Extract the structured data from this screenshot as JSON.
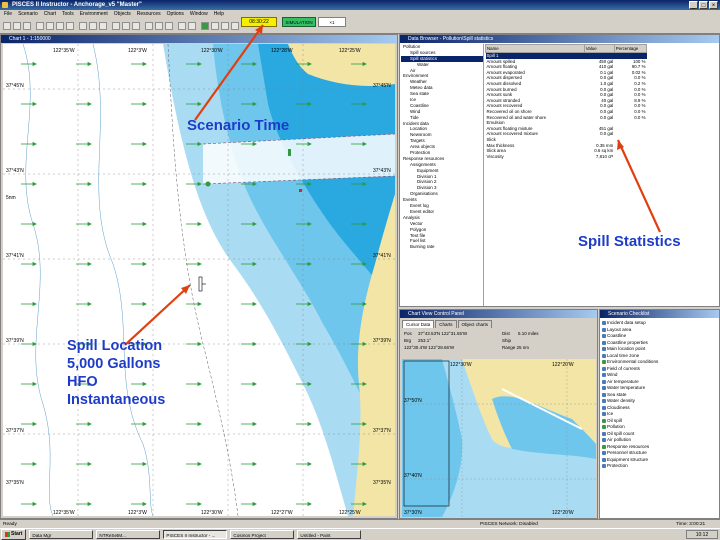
{
  "app": {
    "title": "PISCES II Instructor - Anchorage_v5 \"Master\"",
    "window_buttons": [
      "_",
      "□",
      "×"
    ]
  },
  "menu": [
    "File",
    "Scenario",
    "Chart",
    "Tools",
    "Environment",
    "Objects",
    "Resources",
    "Options",
    "Window",
    "Help"
  ],
  "toolbar": {
    "scenario_time": "08:30:22",
    "green_label": "SIMULATION",
    "speed": "×1"
  },
  "chart_window": {
    "title": "Chart 1 - 1:150000",
    "lon_labels": [
      "122°35'W",
      "122°3'W",
      "122°30'W",
      "122°28'W",
      "122°25'W"
    ],
    "lon_labels_bottom": [
      "122°35'W",
      "122°3'W",
      "122°30'W",
      "122°27'W",
      "122°25'W"
    ],
    "lat_labels_left": [
      "37°45'N",
      "37°43'N",
      "37°41'N",
      "37°39'N",
      "37°37'N",
      "37°35'N"
    ],
    "lat_labels_right": [
      "37°45'N",
      "37°43'N",
      "37°41'N",
      "37°39'N",
      "37°37'N",
      "37°35'N"
    ],
    "scale_label": "5nm"
  },
  "data_browser": {
    "title": "Data Browser - Pollution\\Spill statistics",
    "tree": [
      {
        "indent": 0,
        "label": "Pollution"
      },
      {
        "indent": 1,
        "label": "Spill sources"
      },
      {
        "indent": 1,
        "label": "Spill statistics",
        "selected": true
      },
      {
        "indent": 2,
        "label": "Water"
      },
      {
        "indent": 1,
        "label": "Air"
      },
      {
        "indent": 0,
        "label": "Environment"
      },
      {
        "indent": 1,
        "label": "Weather"
      },
      {
        "indent": 1,
        "label": "Meteo data"
      },
      {
        "indent": 1,
        "label": "Sea state"
      },
      {
        "indent": 1,
        "label": "Ice"
      },
      {
        "indent": 1,
        "label": "Coastline"
      },
      {
        "indent": 1,
        "label": "Wind"
      },
      {
        "indent": 1,
        "label": "Tide"
      },
      {
        "indent": 0,
        "label": "Incident data"
      },
      {
        "indent": 1,
        "label": "Location"
      },
      {
        "indent": 1,
        "label": "Newsroom"
      },
      {
        "indent": 1,
        "label": "Targets"
      },
      {
        "indent": 1,
        "label": "Area objects"
      },
      {
        "indent": 1,
        "label": "Protection"
      },
      {
        "indent": 0,
        "label": "Response resources"
      },
      {
        "indent": 1,
        "label": "Assignments"
      },
      {
        "indent": 2,
        "label": "Equipment"
      },
      {
        "indent": 2,
        "label": "Division 1"
      },
      {
        "indent": 2,
        "label": "Division 2"
      },
      {
        "indent": 2,
        "label": "Division 3"
      },
      {
        "indent": 1,
        "label": "Organisations"
      },
      {
        "indent": 0,
        "label": "Events"
      },
      {
        "indent": 1,
        "label": "Event log"
      },
      {
        "indent": 1,
        "label": "Event editor"
      },
      {
        "indent": 0,
        "label": "Analysis"
      },
      {
        "indent": 1,
        "label": "Vector"
      },
      {
        "indent": 1,
        "label": "Polygon"
      },
      {
        "indent": 1,
        "label": "Text file"
      },
      {
        "indent": 1,
        "label": "Fuel list"
      },
      {
        "indent": 1,
        "label": "Burning rate"
      }
    ],
    "columns": [
      "Name",
      "Value",
      "Percentage"
    ],
    "rows": [
      {
        "name": "Spill 1",
        "value": "",
        "pct": "",
        "sel": true
      },
      {
        "name": "Amount spilled",
        "value": "450 gal",
        "pct": "100 %"
      },
      {
        "name": "Amount floating",
        "value": "410 gal",
        "pct": "90.7 %"
      },
      {
        "name": "Amount evaporated",
        "value": "0.1 gal",
        "pct": "0.02 %"
      },
      {
        "name": "Amount dispersed",
        "value": "0.0 gal",
        "pct": "0.0 %"
      },
      {
        "name": "Amount dissolved",
        "value": "1.0 gal",
        "pct": "0.2 %"
      },
      {
        "name": "Amount burned",
        "value": "0.0 gal",
        "pct": "0.0 %"
      },
      {
        "name": "Amount sunk",
        "value": "0.0 gal",
        "pct": "0.0 %"
      },
      {
        "name": "Amount stranded",
        "value": "40 gal",
        "pct": "8.9 %"
      },
      {
        "name": "Amount recovered",
        "value": "0.0 gal",
        "pct": "0.0 %"
      },
      {
        "name": "Recovered oil on shore",
        "value": "0.0 gal",
        "pct": "0.0 %"
      },
      {
        "name": "Recovered oil and water shore",
        "value": "0.0 gal",
        "pct": "0.0 %"
      },
      {
        "name": "Emulsion",
        "value": "",
        "pct": ""
      },
      {
        "name": "Amount floating mixture",
        "value": "451 gal",
        "pct": ""
      },
      {
        "name": "Amount recovered mixture",
        "value": "0.0 gal",
        "pct": ""
      },
      {
        "name": "Slick",
        "value": "",
        "pct": ""
      },
      {
        "name": "Max thickness",
        "value": "0.35 mm",
        "pct": ""
      },
      {
        "name": "Slick area",
        "value": "0.6 sq km",
        "pct": ""
      },
      {
        "name": "Viscosity",
        "value": "7,810 cP",
        "pct": ""
      }
    ]
  },
  "view_control": {
    "title": "Chart View Control Panel",
    "tabs": [
      "Cursor Data",
      "Charts",
      "Object charts"
    ],
    "pos_label": "Pos",
    "pos_value": "37°43.53'N 122°31.55'W",
    "dist_label": "Dist",
    "dist_value": "5.10 miles",
    "brg_label": "Brg",
    "brg_value": "253.1°",
    "row2": "122°30.4'W  122°28.66'W",
    "row3": "Ship",
    "row4": "Range 25 nm",
    "minimap_lon": [
      "122°30'W",
      "122°20'W"
    ],
    "minimap_lat": [
      "37°50'N",
      "37°40'N",
      "37°30'N"
    ]
  },
  "checklist": {
    "title": "Scenario Checklist",
    "items": [
      {
        "label": "Incident data setup",
        "icon": "blue"
      },
      {
        "label": "Layout area",
        "icon": "blue"
      },
      {
        "label": "Coastline",
        "icon": "blue"
      },
      {
        "label": "Coastline properties",
        "icon": "blue"
      },
      {
        "label": "Main location point",
        "icon": "blue"
      },
      {
        "label": "Local time zone",
        "icon": "blue"
      },
      {
        "label": "Environmental conditions",
        "icon": "green"
      },
      {
        "label": "Field of currents",
        "icon": "blue"
      },
      {
        "label": "Wind",
        "icon": "blue"
      },
      {
        "label": "Air temperature",
        "icon": "blue"
      },
      {
        "label": "Water temperature",
        "icon": "blue"
      },
      {
        "label": "Sea state",
        "icon": "blue"
      },
      {
        "label": "Water density",
        "icon": "blue"
      },
      {
        "label": "Cloudiness",
        "icon": "blue"
      },
      {
        "label": "Ice",
        "icon": "blue"
      },
      {
        "label": "Oil spill",
        "icon": "green"
      },
      {
        "label": "Pollution",
        "icon": "green"
      },
      {
        "label": "Oil spill count",
        "icon": "blue"
      },
      {
        "label": "Air pollution",
        "icon": "blue"
      },
      {
        "label": "Response resources",
        "icon": "green"
      },
      {
        "label": "Personnel structure",
        "icon": "blue"
      },
      {
        "label": "Equipment structure",
        "icon": "blue"
      },
      {
        "label": "Protection",
        "icon": "blue"
      }
    ]
  },
  "statusbar": {
    "left": "Ready",
    "center": "PISCES Network: Disabled",
    "right": "Time: 3:00:21"
  },
  "taskbar": {
    "start": "Start",
    "tasks": [
      "Data Mgr",
      "NTReSetM...",
      "PISCES II Instructor - ...",
      "Cosmos Project",
      "Untitled - Paint"
    ],
    "clock": "10:12"
  },
  "annotations": {
    "scenario_time": "Scenario Time",
    "spill_statistics": "Spill Statistics",
    "spill_location": [
      "Spill Location",
      "5,000 Gallons",
      "HFO",
      "Instantaneous"
    ]
  },
  "colors": {
    "annotation_text": "#1e3cc8",
    "arrow": "#e04010",
    "deep_water": "#2aa8e0",
    "mid_water": "#6fc6ec",
    "shallow_water": "#a9dcf3",
    "land": "#f2e5a6",
    "scenario_time_bg": "#f5f000"
  }
}
